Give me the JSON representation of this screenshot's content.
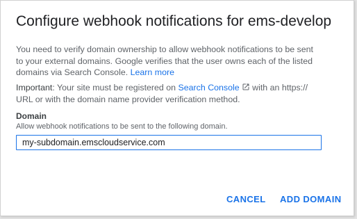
{
  "dialog": {
    "title": "Configure webhook notifications for ems-develop",
    "intro": {
      "text": "You need to verify domain ownership to allow webhook notifications to be sent to your external domains. Google verifies that the user owns each of the listed domains via Search Console.",
      "learn_more": "Learn more"
    },
    "important": {
      "label": "Important",
      "text_before": ": Your site must be registered on ",
      "search_console": "Search Console",
      "text_after": " with an https:// URL or with the domain name provider verification method."
    },
    "domain_field": {
      "label": "Domain",
      "help": "Allow webhook notifications to be sent to the following domain.",
      "value": "my-subdomain.emscloudservice.com"
    },
    "actions": {
      "cancel": "CANCEL",
      "add_domain": "ADD DOMAIN"
    },
    "colors": {
      "accent": "#1a73e8",
      "text_primary": "#202124",
      "text_secondary": "#5f6368"
    },
    "icons": {
      "external_link": "open-in-new-icon"
    }
  }
}
